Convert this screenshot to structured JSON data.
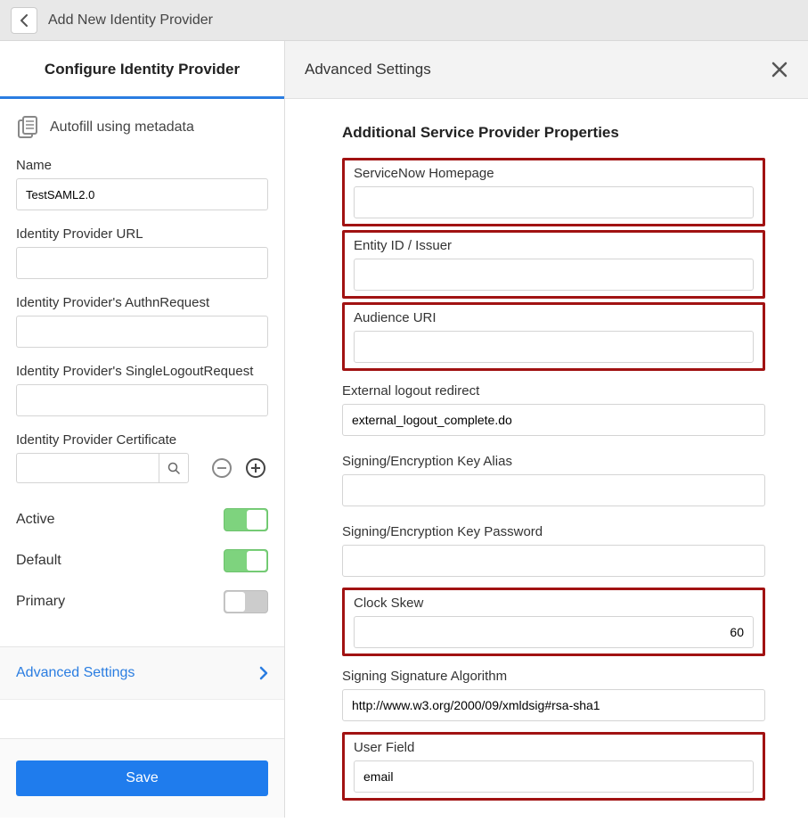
{
  "header": {
    "title": "Add New Identity Provider"
  },
  "sidebar": {
    "heading": "Configure Identity Provider",
    "autofill_label": "Autofill using metadata",
    "fields": {
      "name_label": "Name",
      "name_value": "TestSAML2.0",
      "idp_url_label": "Identity Provider URL",
      "idp_url_value": "",
      "authn_label": "Identity Provider's AuthnRequest",
      "authn_value": "",
      "slo_label": "Identity Provider's SingleLogoutRequest",
      "slo_value": "",
      "cert_label": "Identity Provider Certificate",
      "cert_value": ""
    },
    "toggles": {
      "active_label": "Active",
      "active_on": true,
      "default_label": "Default",
      "default_on": true,
      "primary_label": "Primary",
      "primary_on": false
    },
    "advanced_link": "Advanced Settings",
    "save_label": "Save"
  },
  "main": {
    "title": "Advanced Settings",
    "section_title": "Additional Service Provider Properties",
    "fields": [
      {
        "key": "homepage",
        "label": "ServiceNow Homepage",
        "value": "",
        "highlight": true,
        "align": "left"
      },
      {
        "key": "entity_id",
        "label": "Entity ID / Issuer",
        "value": "",
        "highlight": true,
        "align": "left"
      },
      {
        "key": "audience_uri",
        "label": "Audience URI",
        "value": "",
        "highlight": true,
        "align": "left"
      },
      {
        "key": "ext_logout",
        "label": "External logout redirect",
        "value": "external_logout_complete.do",
        "highlight": false,
        "align": "left"
      },
      {
        "key": "key_alias",
        "label": "Signing/Encryption Key Alias",
        "value": "",
        "highlight": false,
        "align": "left"
      },
      {
        "key": "key_pw",
        "label": "Signing/Encryption Key Password",
        "value": "",
        "highlight": false,
        "align": "left"
      },
      {
        "key": "clock_skew",
        "label": "Clock Skew",
        "value": "60",
        "highlight": true,
        "align": "right"
      },
      {
        "key": "sig_alg",
        "label": "Signing Signature Algorithm",
        "value": "http://www.w3.org/2000/09/xmldsig#rsa-sha1",
        "highlight": false,
        "align": "left"
      },
      {
        "key": "user_field",
        "label": "User Field",
        "value": "email",
        "highlight": true,
        "align": "left"
      }
    ]
  }
}
